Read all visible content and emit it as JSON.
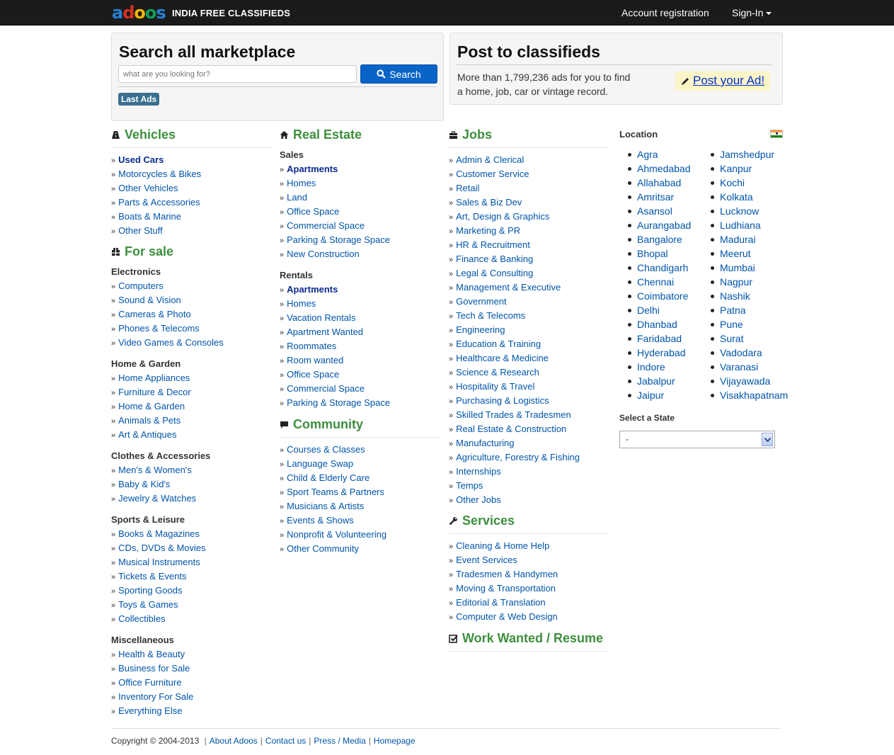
{
  "topbar": {
    "brand_text": "INDIA FREE CLASSIFIEDS",
    "nav_registration": "Account registration",
    "nav_signin": "Sign-In"
  },
  "search": {
    "title": "Search all marketplace",
    "placeholder": "what are you looking for?",
    "button_label": "Search",
    "last_ads_label": "Last Ads"
  },
  "post": {
    "title": "Post to classifieds",
    "text_line1": "More than 1,799,236 ads for you to find",
    "text_line2": "a home, job, car or vintage record.",
    "button_label": "Post your Ad!"
  },
  "vehicles": {
    "title": "Vehicles",
    "items": [
      "Used Cars",
      "Motorcycles & Bikes",
      "Other Vehicles",
      "Parts & Accessories",
      "Boats & Marine",
      "Other Stuff"
    ]
  },
  "forsale": {
    "title": "For sale",
    "groups": [
      {
        "name": "Electronics",
        "items": [
          "Computers",
          "Sound & Vision",
          "Cameras & Photo",
          "Phones & Telecoms",
          "Video Games & Consoles"
        ]
      },
      {
        "name": "Home & Garden",
        "items": [
          "Home Appliances",
          "Furniture & Decor",
          "Home & Garden",
          "Animals & Pets",
          "Art & Antiques"
        ]
      },
      {
        "name": "Clothes & Accessories",
        "items": [
          "Men's & Women's",
          "Baby & Kid's",
          "Jewelry & Watches"
        ]
      },
      {
        "name": "Sports & Leisure",
        "items": [
          "Books & Magazines",
          "CDs, DVDs & Movies",
          "Musical Instruments",
          "Tickets & Events",
          "Sporting Goods",
          "Toys & Games",
          "Collectibles"
        ]
      },
      {
        "name": "Miscellaneous",
        "items": [
          "Health & Beauty",
          "Business for Sale",
          "Office Furniture",
          "Inventory For Sale",
          "Everything Else"
        ]
      }
    ]
  },
  "realestate": {
    "title": "Real Estate",
    "groups": [
      {
        "name": "Sales",
        "items": [
          "Apartments",
          "Homes",
          "Land",
          "Office Space",
          "Commercial Space",
          "Parking & Storage Space",
          "New Construction"
        ]
      },
      {
        "name": "Rentals",
        "items": [
          "Apartments",
          "Homes",
          "Vacation Rentals",
          "Apartment Wanted",
          "Roommates",
          "Room wanted",
          "Office Space",
          "Commercial Space",
          "Parking & Storage Space"
        ]
      }
    ]
  },
  "community": {
    "title": "Community",
    "items": [
      "Courses & Classes",
      "Language Swap",
      "Child & Elderly Care",
      "Sport Teams & Partners",
      "Musicians & Artists",
      "Events & Shows",
      "Nonprofit & Volunteering",
      "Other Community"
    ]
  },
  "jobs": {
    "title": "Jobs",
    "items": [
      "Admin & Clerical",
      "Customer Service",
      "Retail",
      "Sales & Biz Dev",
      "Art, Design & Graphics",
      "Marketing & PR",
      "HR & Recruitment",
      "Finance & Banking",
      "Legal & Consulting",
      "Management & Executive",
      "Government",
      "Tech & Telecoms",
      "Engineering",
      "Education & Training",
      "Healthcare & Medicine",
      "Science & Research",
      "Hospitality & Travel",
      "Purchasing & Logistics",
      "Skilled Trades & Tradesmen",
      "Real Estate & Construction",
      "Manufacturing",
      "Agriculture, Forestry & Fishing",
      "Internships",
      "Temps",
      "Other Jobs"
    ]
  },
  "services": {
    "title": "Services",
    "items": [
      "Cleaning & Home Help",
      "Event Services",
      "Tradesmen & Handymen",
      "Moving & Transportation",
      "Editorial & Translation",
      "Computer & Web Design"
    ]
  },
  "work": {
    "title": "Work Wanted / Resume"
  },
  "location": {
    "title": "Location",
    "cities_col1": [
      "Agra",
      "Ahmedabad",
      "Allahabad",
      "Amritsar",
      "Asansol",
      "Aurangabad",
      "Bangalore",
      "Bhopal",
      "Chandigarh",
      "Chennai",
      "Coimbatore",
      "Delhi",
      "Dhanbad",
      "Faridabad",
      "Hyderabad",
      "Indore",
      "Jabalpur",
      "Jaipur"
    ],
    "cities_col2": [
      "Jamshedpur",
      "Kanpur",
      "Kochi",
      "Kolkata",
      "Lucknow",
      "Ludhiana",
      "Madurai",
      "Meerut",
      "Mumbai",
      "Nagpur",
      "Nashik",
      "Patna",
      "Pune",
      "Surat",
      "Vadodara",
      "Varanasi",
      "Vijayawada",
      "Visakhapatnam"
    ],
    "state_label": "Select a State",
    "state_value": "-"
  },
  "footer": {
    "copyright": "Copyright © 2004-2013",
    "links": [
      "About Adoos",
      "Contact us",
      "Press / Media",
      "Homepage"
    ]
  },
  "colors": {
    "section_green": "#3d8f3d",
    "link_blue": "#0055aa",
    "search_button": "#0a64c8",
    "topbar": "#1b1b1b"
  }
}
